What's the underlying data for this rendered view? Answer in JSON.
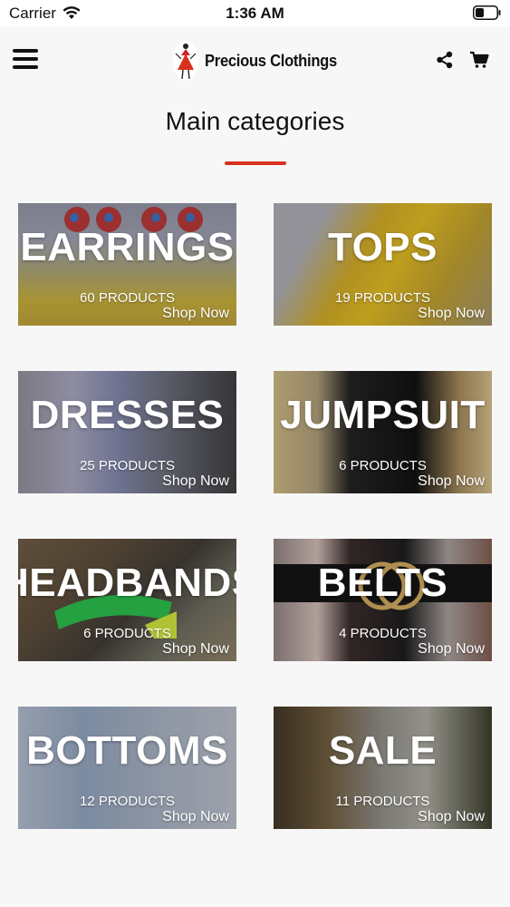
{
  "status_bar": {
    "carrier": "Carrier",
    "time": "1:36 AM"
  },
  "header": {
    "brand": "Precious Clothings"
  },
  "page": {
    "title": "Main categories"
  },
  "categories": [
    {
      "name": "EARRINGS",
      "count": "60 PRODUCTS",
      "cta": "Shop Now"
    },
    {
      "name": "TOPS",
      "count": "19 PRODUCTS",
      "cta": "Shop Now"
    },
    {
      "name": "DRESSES",
      "count": "25 PRODUCTS",
      "cta": "Shop Now"
    },
    {
      "name": "JUMPSUIT",
      "count": "6 PRODUCTS",
      "cta": "Shop Now"
    },
    {
      "name": "HEADBANDS",
      "count": "6 PRODUCTS",
      "cta": "Shop Now"
    },
    {
      "name": "BELTS",
      "count": "4 PRODUCTS",
      "cta": "Shop Now"
    },
    {
      "name": "BOTTOMS",
      "count": "12 PRODUCTS",
      "cta": "Shop Now"
    },
    {
      "name": "SALE",
      "count": "11 PRODUCTS",
      "cta": "Shop Now"
    }
  ],
  "icons": {
    "menu": "hamburger-icon",
    "share": "share-icon",
    "cart": "cart-icon",
    "wifi": "wifi-icon",
    "battery": "battery-icon",
    "logo": "brand-logo"
  },
  "colors": {
    "accent": "#d8321f",
    "background": "#f7f7f8"
  }
}
